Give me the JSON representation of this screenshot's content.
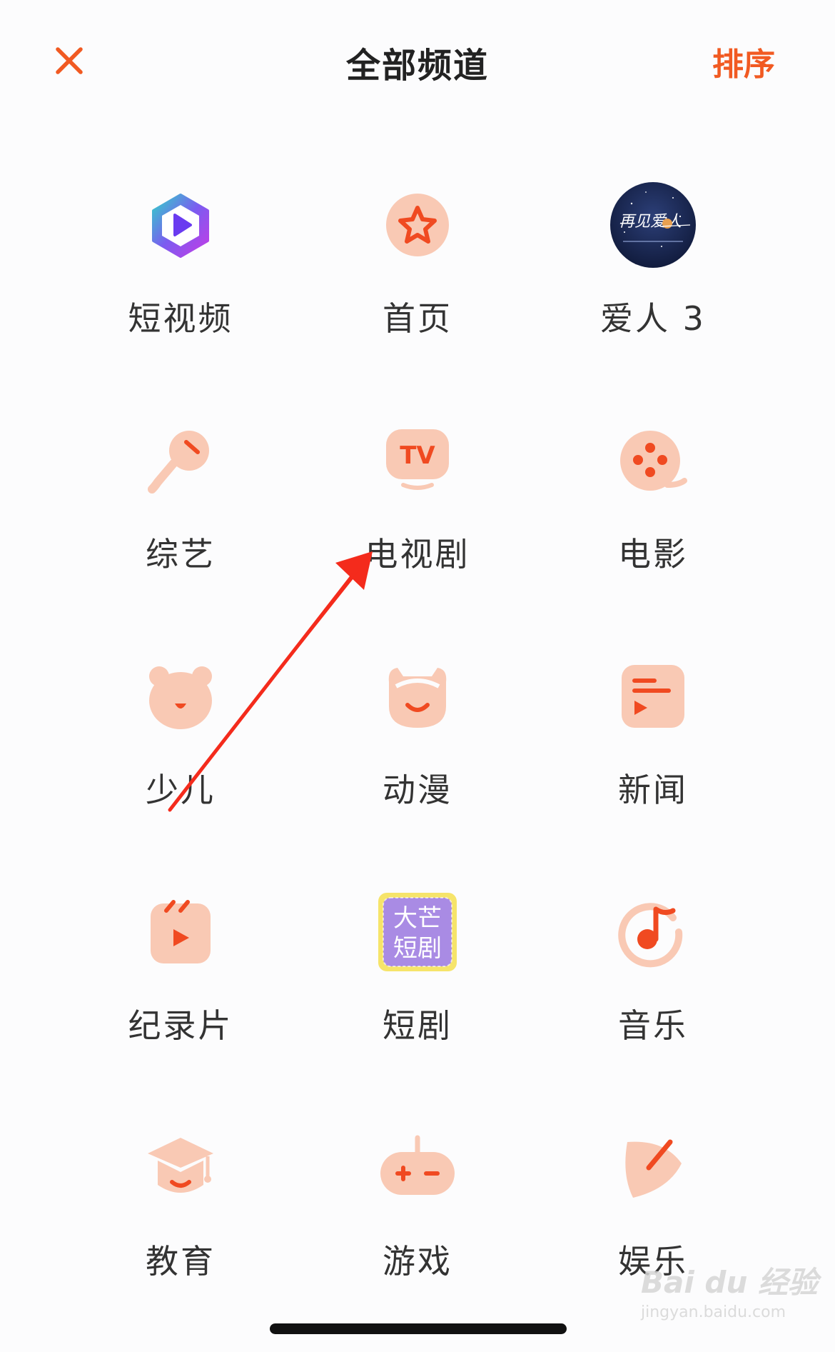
{
  "header": {
    "title": "全部频道",
    "sort_label": "排序"
  },
  "channels": [
    {
      "label": "短视频",
      "icon": "short-video-icon"
    },
    {
      "label": "首页",
      "icon": "home-star-icon"
    },
    {
      "label": "爱人 3",
      "icon": "drama-thumbnail",
      "thumb_text": "再见爱人"
    },
    {
      "label": "综艺",
      "icon": "microphone-icon"
    },
    {
      "label": "电视剧",
      "icon": "tv-icon",
      "icon_text": "TV"
    },
    {
      "label": "电影",
      "icon": "film-reel-icon"
    },
    {
      "label": "少儿",
      "icon": "bear-icon"
    },
    {
      "label": "动漫",
      "icon": "anime-face-icon"
    },
    {
      "label": "新闻",
      "icon": "news-icon"
    },
    {
      "label": "纪录片",
      "icon": "documentary-icon"
    },
    {
      "label": "短剧",
      "icon": "short-drama-badge",
      "badge_lines": [
        "大芒",
        "短剧"
      ]
    },
    {
      "label": "音乐",
      "icon": "music-note-icon"
    },
    {
      "label": "教育",
      "icon": "graduation-cap-icon"
    },
    {
      "label": "游戏",
      "icon": "gamepad-icon"
    },
    {
      "label": "娱乐",
      "icon": "entertainment-leaf-icon"
    }
  ],
  "watermark": {
    "main": "Bai du 经验",
    "sub": "jingyan.baidu.com"
  },
  "colors": {
    "accent": "#f15a22",
    "icon_fill": "#f9c9b4",
    "icon_accent": "#f04a21",
    "title": "#222222",
    "label": "#333333",
    "short_drama_badge": "#a98be4",
    "arrow": "#f42b1c"
  }
}
